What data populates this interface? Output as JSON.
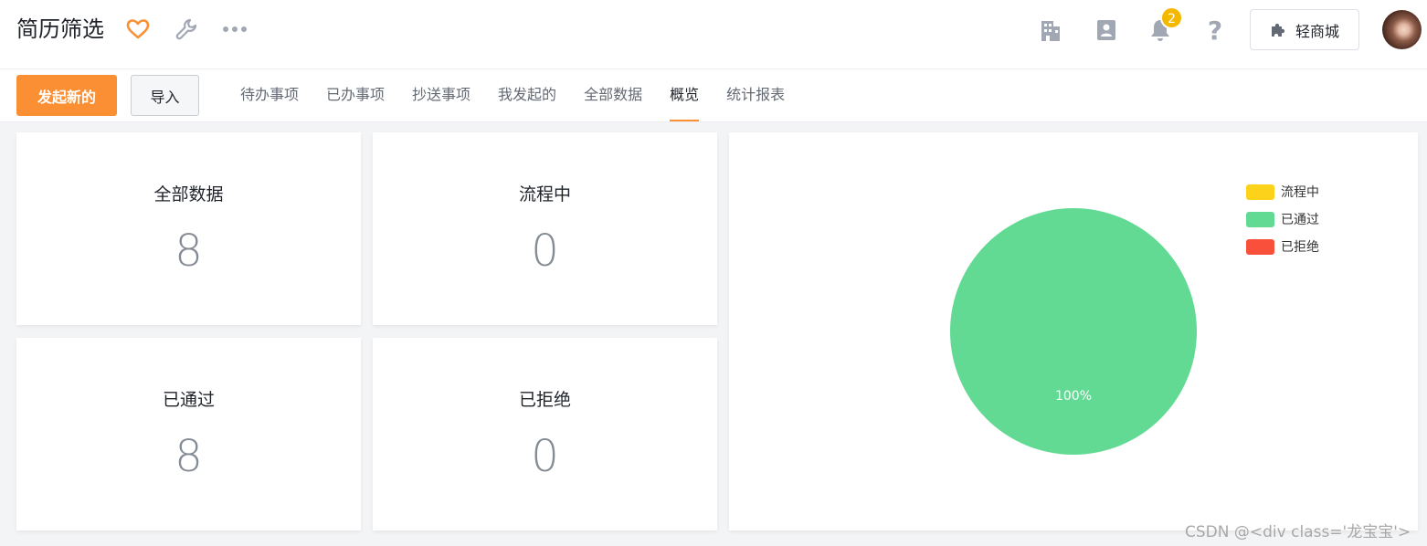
{
  "header": {
    "title": "简历筛选",
    "notification_count": "2",
    "shop_button_label": "轻商城",
    "icons": [
      "heart-icon",
      "wrench-icon",
      "more-icon",
      "building-icon",
      "contacts-icon",
      "bell-icon",
      "help-icon",
      "puzzle-icon"
    ]
  },
  "actions": {
    "new_label": "发起新的",
    "import_label": "导入"
  },
  "tabs": [
    {
      "label": "待办事项",
      "active": false
    },
    {
      "label": "已办事项",
      "active": false
    },
    {
      "label": "抄送事项",
      "active": false
    },
    {
      "label": "我发起的",
      "active": false
    },
    {
      "label": "全部数据",
      "active": false
    },
    {
      "label": "概览",
      "active": true
    },
    {
      "label": "统计报表",
      "active": false
    }
  ],
  "stats": [
    {
      "label": "全部数据",
      "value": "8"
    },
    {
      "label": "流程中",
      "value": "0"
    },
    {
      "label": "已通过",
      "value": "8"
    },
    {
      "label": "已拒绝",
      "value": "0"
    }
  ],
  "colors": {
    "accent": "#fa8f34",
    "in_progress": "#fcd21a",
    "approved": "#62da94",
    "rejected": "#f9503c"
  },
  "chart_data": {
    "type": "pie",
    "legend_position": "top-right",
    "series": [
      {
        "name": "流程中",
        "value": 0,
        "color": "#fcd21a"
      },
      {
        "name": "已通过",
        "value": 8,
        "color": "#62da94"
      },
      {
        "name": "已拒绝",
        "value": 0,
        "color": "#f9503c"
      }
    ],
    "slice_labels": [
      "100%"
    ]
  },
  "watermark": "CSDN @<div class='龙宝宝'>"
}
